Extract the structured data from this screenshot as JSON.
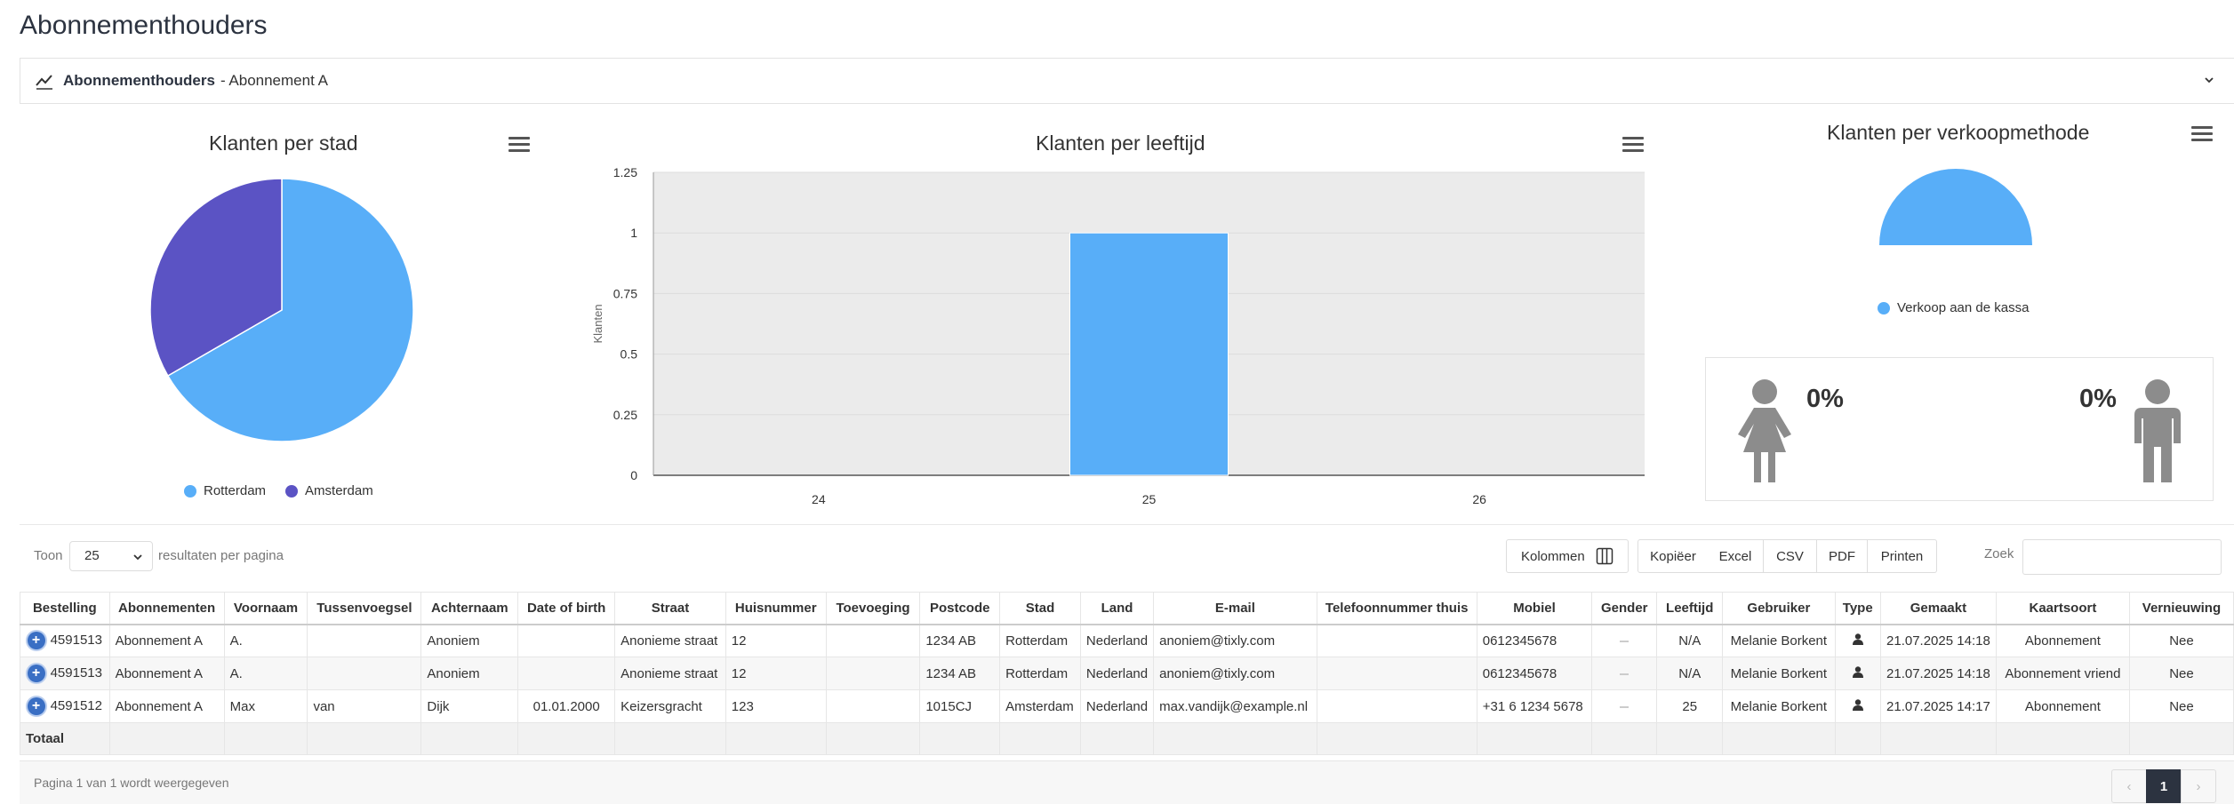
{
  "page": {
    "title": "Abonnementhouders"
  },
  "panel": {
    "title": "Abonnementhouders",
    "subtitle": "- Abonnement A"
  },
  "charts": {
    "city_title": "Klanten per stad",
    "age_title": "Klanten per leeftijd",
    "method_title": "Klanten per verkoopmethode"
  },
  "chart_data": [
    {
      "type": "pie",
      "title": "Klanten per stad",
      "categories": [
        "Rotterdam",
        "Amsterdam"
      ],
      "values": [
        2,
        1
      ],
      "colors": [
        "#58aef8",
        "#5b53c4"
      ],
      "legend": "bottom"
    },
    {
      "type": "bar",
      "title": "Klanten per leeftijd",
      "categories": [
        "24",
        "25",
        "26"
      ],
      "values": [
        0,
        1,
        0
      ],
      "ylabel": "Klanten",
      "yticks": [
        "0",
        "0.25",
        "0.5",
        "0.75",
        "1",
        "1.25"
      ],
      "ylim": [
        0,
        1.25
      ],
      "colors": [
        "#58aef8"
      ],
      "grid": true
    },
    {
      "type": "pie",
      "title": "Klanten per verkoopmethode",
      "categories": [
        "Verkoop aan de kassa"
      ],
      "values": [
        3
      ],
      "colors": [
        "#58aef8"
      ],
      "style": "semi-circle",
      "legend": "bottom"
    }
  ],
  "gender": {
    "female_pct": "0%",
    "male_pct": "0%"
  },
  "toolbar": {
    "show_label": "Toon",
    "page_length": "25",
    "per_page_label": "resultaten per pagina",
    "columns_button": "Kolommen",
    "copy_button": "Kopiëer",
    "excel_button": "Excel",
    "csv_button": "CSV",
    "pdf_button": "PDF",
    "print_button": "Printen",
    "search_label": "Zoek"
  },
  "table": {
    "columns": [
      "Bestelling",
      "Abonnementen",
      "Voornaam",
      "Tussenvoegsel",
      "Achternaam",
      "Date of birth",
      "Straat",
      "Huisnummer",
      "Toevoeging",
      "Postcode",
      "Stad",
      "Land",
      "E-mail",
      "Telefoonnummer thuis",
      "Mobiel",
      "Gender",
      "Leeftijd",
      "Gebruiker",
      "Type",
      "Gemaakt",
      "Kaartsoort",
      "Vernieuwing"
    ],
    "rows": [
      [
        "4591513",
        "Abonnement A",
        "A.",
        "",
        "Anoniem",
        "",
        "Anonieme straat",
        "12",
        "",
        "1234 AB",
        "Rotterdam",
        "Nederland",
        "anoniem@tixly.com",
        "",
        "0612345678",
        "",
        "N/A",
        "Melanie Borkent",
        "",
        "21.07.2025 14:18",
        "Abonnement",
        "Nee"
      ],
      [
        "4591513",
        "Abonnement A",
        "A.",
        "",
        "Anoniem",
        "",
        "Anonieme straat",
        "12",
        "",
        "1234 AB",
        "Rotterdam",
        "Nederland",
        "anoniem@tixly.com",
        "",
        "0612345678",
        "",
        "N/A",
        "Melanie Borkent",
        "",
        "21.07.2025 14:18",
        "Abonnement vriend",
        "Nee"
      ],
      [
        "4591512",
        "Abonnement A",
        "Max",
        "van",
        "Dijk",
        "01.01.2000",
        "Keizersgracht",
        "123",
        "",
        "1015CJ",
        "Amsterdam",
        "Nederland",
        "max.vandijk@example.nl",
        "",
        "+31 6 1234 5678",
        "",
        "25",
        "Melanie Borkent",
        "",
        "21.07.2025 14:17",
        "Abonnement",
        "Nee"
      ]
    ],
    "total_label": "Totaal"
  },
  "footer": {
    "info": "Pagina 1 van 1 wordt weergegeven",
    "prev": "‹",
    "current_page": "1",
    "next": "›"
  }
}
